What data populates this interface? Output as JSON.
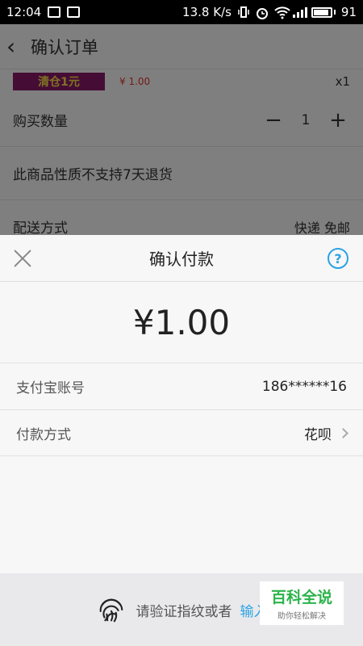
{
  "status_bar": {
    "time": "12:04",
    "speed": "13.8 K/s",
    "battery": "91"
  },
  "page": {
    "title": "确认订单",
    "promo_text": "清仓1元",
    "price": "¥ 1.00",
    "quantity_badge": "x1",
    "quantity_label": "购买数量",
    "quantity_value": "1",
    "minus": "−",
    "plus": "+",
    "notice": "此商品性质不支持7天退货",
    "shipping_label": "配送方式",
    "shipping_value": "快递 免邮"
  },
  "sheet": {
    "title": "确认付款",
    "help": "?",
    "amount": "¥1.00",
    "rows": [
      {
        "label": "支付宝账号",
        "value": "186******16"
      },
      {
        "label": "付款方式",
        "value": "花呗"
      }
    ],
    "bottom_text": "请验证指纹或者",
    "bottom_link": "输入"
  },
  "watermark": {
    "title": "百科全说",
    "subtitle": "助你轻松解决"
  },
  "colors": {
    "accent": "#2aa3e3",
    "price": "#e3382f",
    "watermark_green": "#2cb34a"
  }
}
